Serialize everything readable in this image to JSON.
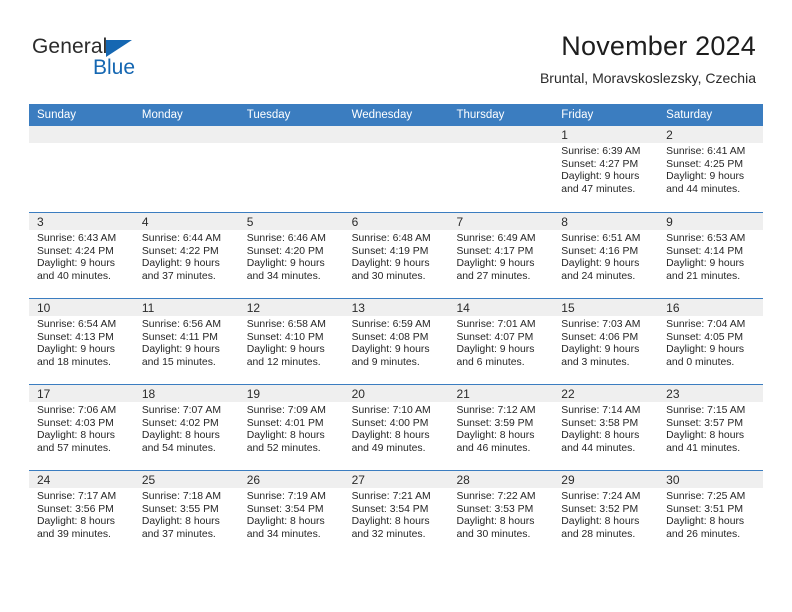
{
  "brand": {
    "name_part1": "General",
    "name_part2": "Blue",
    "flag_icon": "triangle-flag-icon"
  },
  "header": {
    "title": "November 2024",
    "subtitle": "Bruntal, Moravskoslezsky, Czechia"
  },
  "colors": {
    "header_blue": "#3b7dc0",
    "brand_blue": "#1567b2",
    "day_band_gray": "#efefef"
  },
  "calendar": {
    "weekday_headers": [
      "Sunday",
      "Monday",
      "Tuesday",
      "Wednesday",
      "Thursday",
      "Friday",
      "Saturday"
    ],
    "weeks": [
      [
        {
          "day": "",
          "lines": []
        },
        {
          "day": "",
          "lines": []
        },
        {
          "day": "",
          "lines": []
        },
        {
          "day": "",
          "lines": []
        },
        {
          "day": "",
          "lines": []
        },
        {
          "day": "1",
          "lines": [
            "Sunrise: 6:39 AM",
            "Sunset: 4:27 PM",
            "Daylight: 9 hours",
            "and 47 minutes."
          ]
        },
        {
          "day": "2",
          "lines": [
            "Sunrise: 6:41 AM",
            "Sunset: 4:25 PM",
            "Daylight: 9 hours",
            "and 44 minutes."
          ]
        }
      ],
      [
        {
          "day": "3",
          "lines": [
            "Sunrise: 6:43 AM",
            "Sunset: 4:24 PM",
            "Daylight: 9 hours",
            "and 40 minutes."
          ]
        },
        {
          "day": "4",
          "lines": [
            "Sunrise: 6:44 AM",
            "Sunset: 4:22 PM",
            "Daylight: 9 hours",
            "and 37 minutes."
          ]
        },
        {
          "day": "5",
          "lines": [
            "Sunrise: 6:46 AM",
            "Sunset: 4:20 PM",
            "Daylight: 9 hours",
            "and 34 minutes."
          ]
        },
        {
          "day": "6",
          "lines": [
            "Sunrise: 6:48 AM",
            "Sunset: 4:19 PM",
            "Daylight: 9 hours",
            "and 30 minutes."
          ]
        },
        {
          "day": "7",
          "lines": [
            "Sunrise: 6:49 AM",
            "Sunset: 4:17 PM",
            "Daylight: 9 hours",
            "and 27 minutes."
          ]
        },
        {
          "day": "8",
          "lines": [
            "Sunrise: 6:51 AM",
            "Sunset: 4:16 PM",
            "Daylight: 9 hours",
            "and 24 minutes."
          ]
        },
        {
          "day": "9",
          "lines": [
            "Sunrise: 6:53 AM",
            "Sunset: 4:14 PM",
            "Daylight: 9 hours",
            "and 21 minutes."
          ]
        }
      ],
      [
        {
          "day": "10",
          "lines": [
            "Sunrise: 6:54 AM",
            "Sunset: 4:13 PM",
            "Daylight: 9 hours",
            "and 18 minutes."
          ]
        },
        {
          "day": "11",
          "lines": [
            "Sunrise: 6:56 AM",
            "Sunset: 4:11 PM",
            "Daylight: 9 hours",
            "and 15 minutes."
          ]
        },
        {
          "day": "12",
          "lines": [
            "Sunrise: 6:58 AM",
            "Sunset: 4:10 PM",
            "Daylight: 9 hours",
            "and 12 minutes."
          ]
        },
        {
          "day": "13",
          "lines": [
            "Sunrise: 6:59 AM",
            "Sunset: 4:08 PM",
            "Daylight: 9 hours",
            "and 9 minutes."
          ]
        },
        {
          "day": "14",
          "lines": [
            "Sunrise: 7:01 AM",
            "Sunset: 4:07 PM",
            "Daylight: 9 hours",
            "and 6 minutes."
          ]
        },
        {
          "day": "15",
          "lines": [
            "Sunrise: 7:03 AM",
            "Sunset: 4:06 PM",
            "Daylight: 9 hours",
            "and 3 minutes."
          ]
        },
        {
          "day": "16",
          "lines": [
            "Sunrise: 7:04 AM",
            "Sunset: 4:05 PM",
            "Daylight: 9 hours",
            "and 0 minutes."
          ]
        }
      ],
      [
        {
          "day": "17",
          "lines": [
            "Sunrise: 7:06 AM",
            "Sunset: 4:03 PM",
            "Daylight: 8 hours",
            "and 57 minutes."
          ]
        },
        {
          "day": "18",
          "lines": [
            "Sunrise: 7:07 AM",
            "Sunset: 4:02 PM",
            "Daylight: 8 hours",
            "and 54 minutes."
          ]
        },
        {
          "day": "19",
          "lines": [
            "Sunrise: 7:09 AM",
            "Sunset: 4:01 PM",
            "Daylight: 8 hours",
            "and 52 minutes."
          ]
        },
        {
          "day": "20",
          "lines": [
            "Sunrise: 7:10 AM",
            "Sunset: 4:00 PM",
            "Daylight: 8 hours",
            "and 49 minutes."
          ]
        },
        {
          "day": "21",
          "lines": [
            "Sunrise: 7:12 AM",
            "Sunset: 3:59 PM",
            "Daylight: 8 hours",
            "and 46 minutes."
          ]
        },
        {
          "day": "22",
          "lines": [
            "Sunrise: 7:14 AM",
            "Sunset: 3:58 PM",
            "Daylight: 8 hours",
            "and 44 minutes."
          ]
        },
        {
          "day": "23",
          "lines": [
            "Sunrise: 7:15 AM",
            "Sunset: 3:57 PM",
            "Daylight: 8 hours",
            "and 41 minutes."
          ]
        }
      ],
      [
        {
          "day": "24",
          "lines": [
            "Sunrise: 7:17 AM",
            "Sunset: 3:56 PM",
            "Daylight: 8 hours",
            "and 39 minutes."
          ]
        },
        {
          "day": "25",
          "lines": [
            "Sunrise: 7:18 AM",
            "Sunset: 3:55 PM",
            "Daylight: 8 hours",
            "and 37 minutes."
          ]
        },
        {
          "day": "26",
          "lines": [
            "Sunrise: 7:19 AM",
            "Sunset: 3:54 PM",
            "Daylight: 8 hours",
            "and 34 minutes."
          ]
        },
        {
          "day": "27",
          "lines": [
            "Sunrise: 7:21 AM",
            "Sunset: 3:54 PM",
            "Daylight: 8 hours",
            "and 32 minutes."
          ]
        },
        {
          "day": "28",
          "lines": [
            "Sunrise: 7:22 AM",
            "Sunset: 3:53 PM",
            "Daylight: 8 hours",
            "and 30 minutes."
          ]
        },
        {
          "day": "29",
          "lines": [
            "Sunrise: 7:24 AM",
            "Sunset: 3:52 PM",
            "Daylight: 8 hours",
            "and 28 minutes."
          ]
        },
        {
          "day": "30",
          "lines": [
            "Sunrise: 7:25 AM",
            "Sunset: 3:51 PM",
            "Daylight: 8 hours",
            "and 26 minutes."
          ]
        }
      ]
    ]
  }
}
